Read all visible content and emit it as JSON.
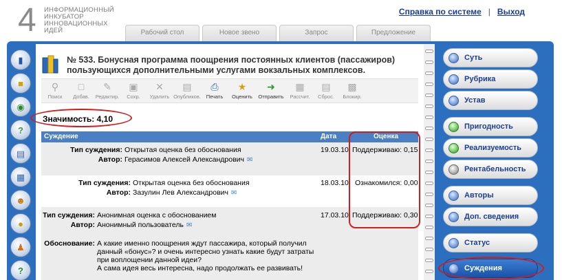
{
  "header": {
    "logo_digit": "4",
    "logo_lines": [
      "ИНФОРМАЦИОННЫЙ",
      "ИНКУБАТОР",
      "ИННОВАЦИОННЫХ",
      "ИДЕЙ"
    ],
    "help_link": "Справка по системе",
    "separator": "|",
    "logout_link": "Выход"
  },
  "tabs": [
    "Рабочий стол",
    "Новое звено",
    "Запрос",
    "Предложение"
  ],
  "left_icons": [
    "book-icon",
    "folder-icon",
    "globe-icon",
    "question-icon",
    "document-icon",
    "calendar-icon",
    "user-icon",
    "coins-icon",
    "person-icon",
    "help-icon"
  ],
  "idea": {
    "title": "№ 533. Бонусная программа поощрения постоянных клиентов (пассажиров) пользующихся дополнительными услугами вокзальных комплексов."
  },
  "toolbar": [
    {
      "label": "Поиск",
      "icon": "search-icon",
      "active": false
    },
    {
      "label": "Добав.",
      "icon": "add-icon",
      "active": false
    },
    {
      "label": "Редактир.",
      "icon": "edit-icon",
      "active": false
    },
    {
      "label": "Сохр.",
      "icon": "save-icon",
      "active": false
    },
    {
      "label": "Удалить",
      "icon": "delete-icon",
      "active": false
    },
    {
      "label": "Опубликов.",
      "icon": "publish-icon",
      "active": false
    },
    {
      "label": "Печать",
      "icon": "print-icon",
      "active": true
    },
    {
      "label": "Оценить",
      "icon": "rate-icon",
      "active": true
    },
    {
      "label": "Отправить",
      "icon": "send-icon",
      "active": true
    },
    {
      "label": "Рассчит.",
      "icon": "calculate-icon",
      "active": false
    },
    {
      "label": "Сброс.",
      "icon": "reset-icon",
      "active": false
    },
    {
      "label": "Блокир.",
      "icon": "lock-icon",
      "active": false
    }
  ],
  "significance": "Значимость: 4,10",
  "table": {
    "col_judgement": "Суждение",
    "col_date": "Дата",
    "col_score": "Оценка",
    "rows": [
      {
        "type_label": "Тип суждения:",
        "type_value": "Открытая оценка без обоснования",
        "author_label": "Автор:",
        "author_value": "Герасимов Алексей Александрович",
        "date": "19.03.10",
        "score": "Поддерживаю: 0,15"
      },
      {
        "type_label": "Тип суждения:",
        "type_value": "Открытая оценка без обоснования",
        "author_label": "Автор:",
        "author_value": "Зазулин Лев Александрович",
        "date": "18.03.10",
        "score": "Ознакомился: 0,00"
      },
      {
        "type_label": "Тип суждения:",
        "type_value": "Анонимная оценка с обоснованием",
        "author_label": "Автор:",
        "author_value": "Анонимный пользователь",
        "date": "17.03.10",
        "score": "Поддерживаю: 0,30",
        "reason_label": "Обоснование:",
        "reason_lines": [
          "А какие именно поощрения ждут пассажира, который получил",
          "данный «бонус»? и очень интересно узнать какие будут затраты",
          "при воплощении данной идеи?",
          "А сама идея весь интересна, надо продолжать ее развивать!"
        ]
      }
    ]
  },
  "right_nav": [
    {
      "label": "Суть",
      "color": "blue"
    },
    {
      "label": "Рубрика",
      "color": "blue"
    },
    {
      "label": "Устав",
      "color": "blue"
    },
    {
      "label": "Пригодность",
      "color": "green"
    },
    {
      "label": "Реализуемость",
      "color": "green"
    },
    {
      "label": "Рентабельность",
      "color": "grey"
    },
    {
      "label": "Авторы",
      "color": "blue"
    },
    {
      "label": "Доп. сведения",
      "color": "blue"
    },
    {
      "label": "Статус",
      "color": "blue"
    },
    {
      "label": "Суждения",
      "color": "blue",
      "active": true
    }
  ],
  "colors": {
    "frame_blue": "#2d6fbf",
    "table_head": "#4a7fc4",
    "highlight_red": "#d41c1c",
    "link_blue": "#1a3a9a"
  }
}
